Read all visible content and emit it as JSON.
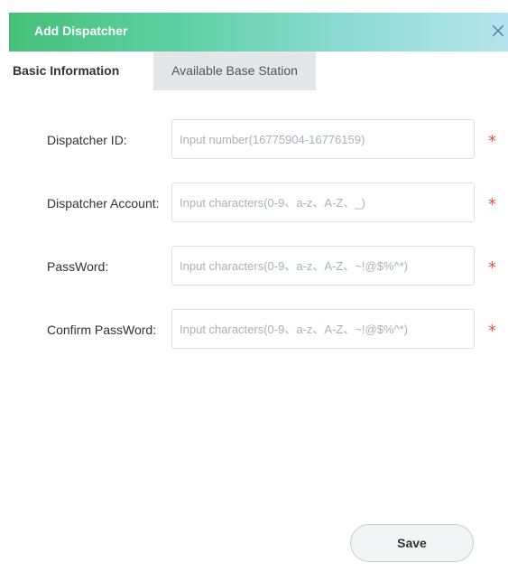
{
  "dialog": {
    "title": "Add Dispatcher",
    "close_glyph": "×",
    "close_icon": "close-icon"
  },
  "tabs": [
    {
      "label": "Basic Information",
      "active": true
    },
    {
      "label": "Available Base Station",
      "active": false
    }
  ],
  "form": {
    "fields": [
      {
        "label": "Dispatcher ID:",
        "value": "",
        "placeholder": "Input number(16775904-16776159)",
        "required": true
      },
      {
        "label": "Dispatcher Account:",
        "value": "",
        "placeholder": "Input characters(0-9、a-z、A-Z、_)",
        "required": true
      },
      {
        "label": "PassWord:",
        "value": "",
        "placeholder": "Input characters(0-9、a-z、A-Z、~!@$%^*)",
        "required": true
      },
      {
        "label": "Confirm PassWord:",
        "value": "",
        "placeholder": "Input characters(0-9、a-z、A-Z、~!@$%^*)",
        "required": true
      }
    ],
    "required_mark": "*",
    "save_label": "Save"
  },
  "colors": {
    "title_gradient_start": "#45c07a",
    "title_gradient_end": "#b6e4ee",
    "required": "#e8524a",
    "inactive_tab_bg": "#e4e6e9"
  }
}
